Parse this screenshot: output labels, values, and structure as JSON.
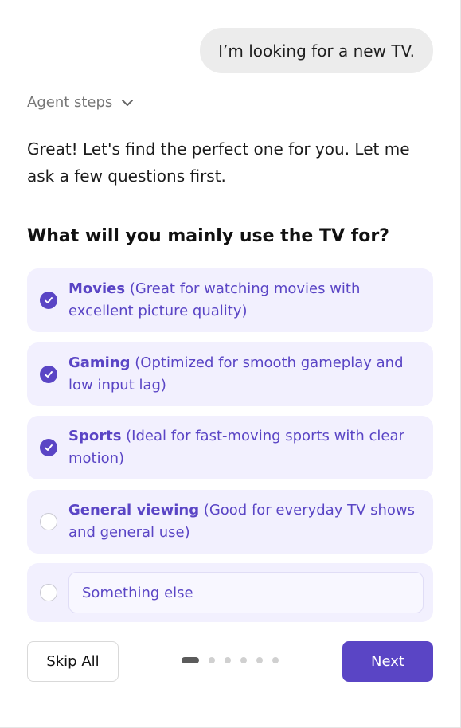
{
  "user_message": "I’m looking for a new TV.",
  "agent_steps": {
    "label": "Agent steps",
    "icon": "chevron-down-icon"
  },
  "assistant_message": "Great! Let's find the perfect one for you. Let me ask a few questions first.",
  "question": "What will you mainly use the TV for?",
  "options": [
    {
      "title": "Movies",
      "description": " (Great for watching movies with excellent picture quality)",
      "checked": true
    },
    {
      "title": "Gaming",
      "description": " (Optimized for smooth gameplay and low input lag)",
      "checked": true
    },
    {
      "title": "Sports",
      "description": " (Ideal for fast-moving sports with clear motion)",
      "checked": true
    },
    {
      "title": "General viewing",
      "description": " (Good for everyday TV shows and general use)",
      "checked": false
    }
  ],
  "other_option": {
    "placeholder": "Something else",
    "checked": false
  },
  "footer": {
    "skip_label": "Skip All",
    "next_label": "Next",
    "page_count": 6,
    "current_page": 1
  },
  "colors": {
    "accent": "#5a45c5",
    "option_bg": "#f2f0fe",
    "bubble_bg": "#ececec"
  }
}
